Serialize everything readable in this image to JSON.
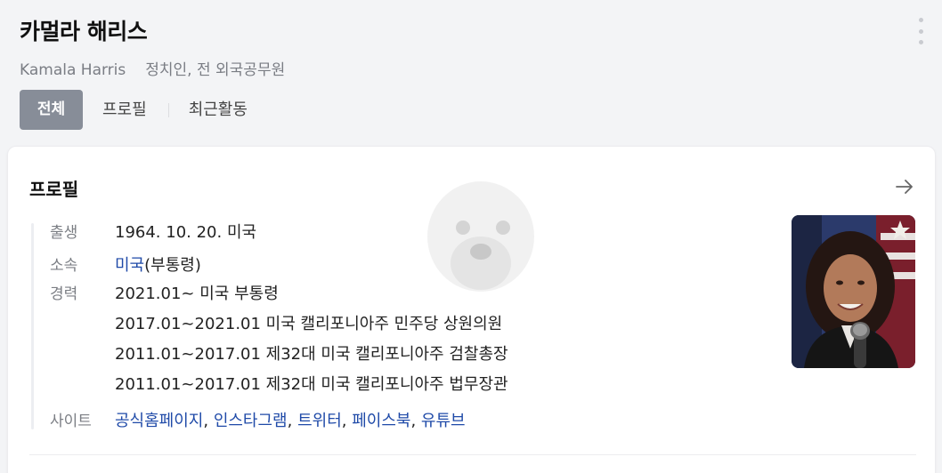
{
  "person": {
    "name": "카멀라 해리스",
    "english_name": "Kamala Harris",
    "occupation": "정치인, 전 외국공무원"
  },
  "tabs": [
    {
      "label": "전체",
      "active": true
    },
    {
      "label": "프로필",
      "active": false
    },
    {
      "label": "최근활동",
      "active": false
    }
  ],
  "profile": {
    "title": "프로필",
    "birth": {
      "label": "출생",
      "value": "1964. 10. 20. 미국"
    },
    "affiliation": {
      "label": "소속",
      "link": "미국",
      "rest": "(부통령)"
    },
    "career": {
      "label": "경력",
      "items": [
        "2021.01~ 미국 부통령",
        "2017.01~2021.01 미국 캘리포니아주 민주당 상원의원",
        "2011.01~2017.01 제32대 미국 캘리포니아주 검찰총장",
        "2011.01~2017.01 제32대 미국 캘리포니아주 법무장관"
      ]
    },
    "site": {
      "label": "사이트",
      "links": [
        "공식홈페이지",
        "인스타그램",
        "트위터",
        "페이스북",
        "유튜브"
      ],
      "separator": ", "
    }
  },
  "colors": {
    "accent_link": "#1f4aa8",
    "active_tab_bg": "#878d98"
  },
  "icons": [
    "more-vertical-icon",
    "arrow-right-icon"
  ]
}
